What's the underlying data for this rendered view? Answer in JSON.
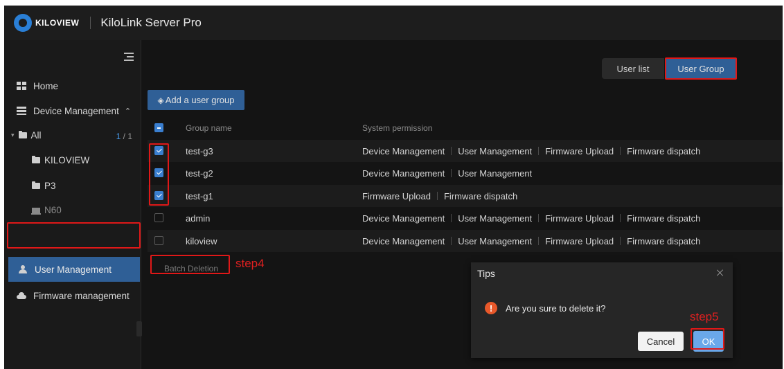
{
  "app": {
    "brand": "KILOVIEW",
    "title": "KiloLink Server Pro"
  },
  "sidebar": {
    "home": "Home",
    "device_management": "Device Management",
    "tree": {
      "all": "All",
      "count_current": "1",
      "count_total": "/ 1",
      "children": [
        "KILOVIEW",
        "P3",
        "N60"
      ]
    },
    "user_management": "User Management",
    "firmware_management": "Firmware management"
  },
  "tabs": {
    "user_list": "User list",
    "user_group": "User Group"
  },
  "toolbar": {
    "add_group": "Add a user group"
  },
  "table": {
    "headers": {
      "name": "Group name",
      "permission": "System permission"
    },
    "rows": [
      {
        "name": "test-g3",
        "checked": true,
        "permissions": [
          "Device Management",
          "User Management",
          "Firmware Upload",
          "Firmware dispatch"
        ]
      },
      {
        "name": "test-g2",
        "checked": true,
        "permissions": [
          "Device Management",
          "User Management"
        ]
      },
      {
        "name": "test-g1",
        "checked": true,
        "permissions": [
          "Firmware Upload",
          "Firmware dispatch"
        ]
      },
      {
        "name": "admin",
        "checked": false,
        "permissions": [
          "Device Management",
          "User Management",
          "Firmware Upload",
          "Firmware dispatch"
        ]
      },
      {
        "name": "kiloview",
        "checked": false,
        "permissions": [
          "Device Management",
          "User Management",
          "Firmware Upload",
          "Firmware dispatch"
        ]
      }
    ]
  },
  "batch_delete": "Batch Deletion",
  "annotations": {
    "step4": "step4",
    "step5": "step5",
    "color": "#e01818"
  },
  "dialog": {
    "title": "Tips",
    "message": "Are you sure to delete it?",
    "cancel": "Cancel",
    "ok": "OK",
    "warn_glyph": "!"
  },
  "colors": {
    "accent": "#2f5f96",
    "checkbox": "#3a7fd0",
    "warning": "#e8582a"
  }
}
